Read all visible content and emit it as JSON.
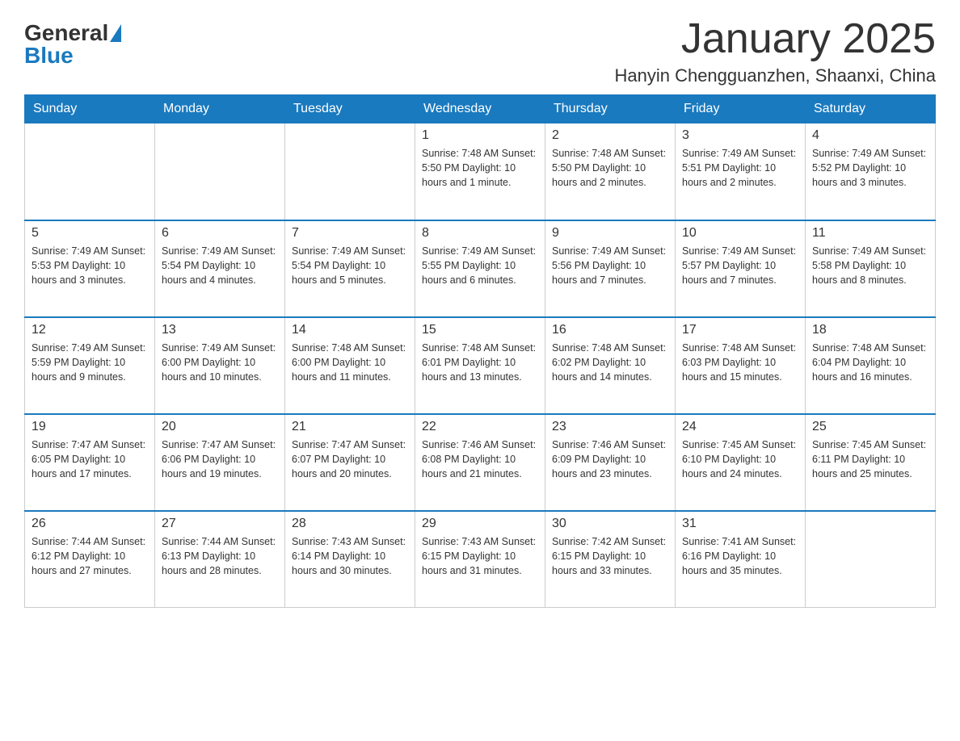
{
  "logo": {
    "general": "General",
    "blue": "Blue"
  },
  "title": "January 2025",
  "location": "Hanyin Chengguanzhen, Shaanxi, China",
  "days_of_week": [
    "Sunday",
    "Monday",
    "Tuesday",
    "Wednesday",
    "Thursday",
    "Friday",
    "Saturday"
  ],
  "weeks": [
    [
      {
        "day": "",
        "info": ""
      },
      {
        "day": "",
        "info": ""
      },
      {
        "day": "",
        "info": ""
      },
      {
        "day": "1",
        "info": "Sunrise: 7:48 AM\nSunset: 5:50 PM\nDaylight: 10 hours and 1 minute."
      },
      {
        "day": "2",
        "info": "Sunrise: 7:48 AM\nSunset: 5:50 PM\nDaylight: 10 hours and 2 minutes."
      },
      {
        "day": "3",
        "info": "Sunrise: 7:49 AM\nSunset: 5:51 PM\nDaylight: 10 hours and 2 minutes."
      },
      {
        "day": "4",
        "info": "Sunrise: 7:49 AM\nSunset: 5:52 PM\nDaylight: 10 hours and 3 minutes."
      }
    ],
    [
      {
        "day": "5",
        "info": "Sunrise: 7:49 AM\nSunset: 5:53 PM\nDaylight: 10 hours and 3 minutes."
      },
      {
        "day": "6",
        "info": "Sunrise: 7:49 AM\nSunset: 5:54 PM\nDaylight: 10 hours and 4 minutes."
      },
      {
        "day": "7",
        "info": "Sunrise: 7:49 AM\nSunset: 5:54 PM\nDaylight: 10 hours and 5 minutes."
      },
      {
        "day": "8",
        "info": "Sunrise: 7:49 AM\nSunset: 5:55 PM\nDaylight: 10 hours and 6 minutes."
      },
      {
        "day": "9",
        "info": "Sunrise: 7:49 AM\nSunset: 5:56 PM\nDaylight: 10 hours and 7 minutes."
      },
      {
        "day": "10",
        "info": "Sunrise: 7:49 AM\nSunset: 5:57 PM\nDaylight: 10 hours and 7 minutes."
      },
      {
        "day": "11",
        "info": "Sunrise: 7:49 AM\nSunset: 5:58 PM\nDaylight: 10 hours and 8 minutes."
      }
    ],
    [
      {
        "day": "12",
        "info": "Sunrise: 7:49 AM\nSunset: 5:59 PM\nDaylight: 10 hours and 9 minutes."
      },
      {
        "day": "13",
        "info": "Sunrise: 7:49 AM\nSunset: 6:00 PM\nDaylight: 10 hours and 10 minutes."
      },
      {
        "day": "14",
        "info": "Sunrise: 7:48 AM\nSunset: 6:00 PM\nDaylight: 10 hours and 11 minutes."
      },
      {
        "day": "15",
        "info": "Sunrise: 7:48 AM\nSunset: 6:01 PM\nDaylight: 10 hours and 13 minutes."
      },
      {
        "day": "16",
        "info": "Sunrise: 7:48 AM\nSunset: 6:02 PM\nDaylight: 10 hours and 14 minutes."
      },
      {
        "day": "17",
        "info": "Sunrise: 7:48 AM\nSunset: 6:03 PM\nDaylight: 10 hours and 15 minutes."
      },
      {
        "day": "18",
        "info": "Sunrise: 7:48 AM\nSunset: 6:04 PM\nDaylight: 10 hours and 16 minutes."
      }
    ],
    [
      {
        "day": "19",
        "info": "Sunrise: 7:47 AM\nSunset: 6:05 PM\nDaylight: 10 hours and 17 minutes."
      },
      {
        "day": "20",
        "info": "Sunrise: 7:47 AM\nSunset: 6:06 PM\nDaylight: 10 hours and 19 minutes."
      },
      {
        "day": "21",
        "info": "Sunrise: 7:47 AM\nSunset: 6:07 PM\nDaylight: 10 hours and 20 minutes."
      },
      {
        "day": "22",
        "info": "Sunrise: 7:46 AM\nSunset: 6:08 PM\nDaylight: 10 hours and 21 minutes."
      },
      {
        "day": "23",
        "info": "Sunrise: 7:46 AM\nSunset: 6:09 PM\nDaylight: 10 hours and 23 minutes."
      },
      {
        "day": "24",
        "info": "Sunrise: 7:45 AM\nSunset: 6:10 PM\nDaylight: 10 hours and 24 minutes."
      },
      {
        "day": "25",
        "info": "Sunrise: 7:45 AM\nSunset: 6:11 PM\nDaylight: 10 hours and 25 minutes."
      }
    ],
    [
      {
        "day": "26",
        "info": "Sunrise: 7:44 AM\nSunset: 6:12 PM\nDaylight: 10 hours and 27 minutes."
      },
      {
        "day": "27",
        "info": "Sunrise: 7:44 AM\nSunset: 6:13 PM\nDaylight: 10 hours and 28 minutes."
      },
      {
        "day": "28",
        "info": "Sunrise: 7:43 AM\nSunset: 6:14 PM\nDaylight: 10 hours and 30 minutes."
      },
      {
        "day": "29",
        "info": "Sunrise: 7:43 AM\nSunset: 6:15 PM\nDaylight: 10 hours and 31 minutes."
      },
      {
        "day": "30",
        "info": "Sunrise: 7:42 AM\nSunset: 6:15 PM\nDaylight: 10 hours and 33 minutes."
      },
      {
        "day": "31",
        "info": "Sunrise: 7:41 AM\nSunset: 6:16 PM\nDaylight: 10 hours and 35 minutes."
      },
      {
        "day": "",
        "info": ""
      }
    ]
  ]
}
